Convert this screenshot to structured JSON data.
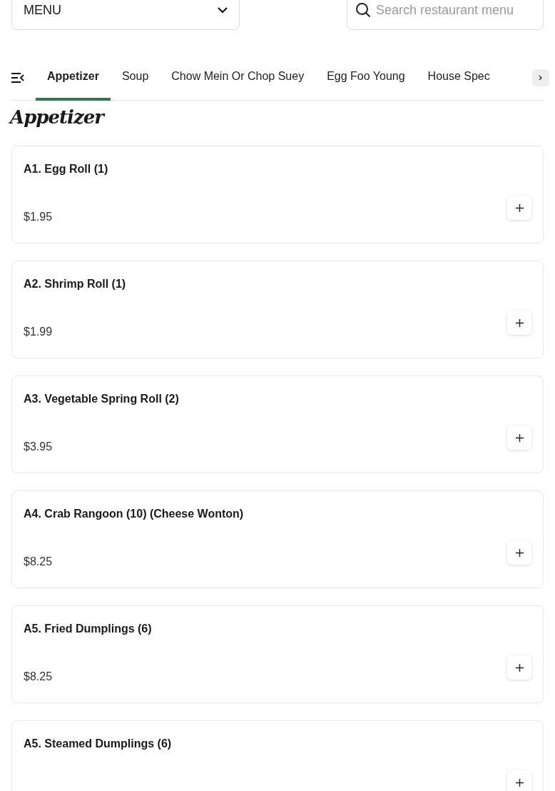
{
  "menu_select": {
    "value": "MENU"
  },
  "search": {
    "placeholder": "Search restaurant menu"
  },
  "tabs": [
    {
      "label": "Appetizer",
      "selected": true
    },
    {
      "label": "Soup",
      "selected": false
    },
    {
      "label": "Chow Mein Or Chop Suey",
      "selected": false
    },
    {
      "label": "Egg Foo Young",
      "selected": false
    },
    {
      "label": "House Spec",
      "selected": false
    }
  ],
  "section_title": "Appetizer",
  "items": [
    {
      "name": "A1. Egg Roll (1)",
      "price": "$1.95"
    },
    {
      "name": "A2. Shrimp Roll (1)",
      "price": "$1.99"
    },
    {
      "name": "A3. Vegetable Spring Roll (2)",
      "price": "$3.95"
    },
    {
      "name": "A4. Crab Rangoon (10) (Cheese Wonton)",
      "price": "$8.25"
    },
    {
      "name": "A5. Fried Dumplings (6)",
      "price": "$8.25"
    },
    {
      "name": "A5. Steamed Dumplings (6)"
    }
  ]
}
